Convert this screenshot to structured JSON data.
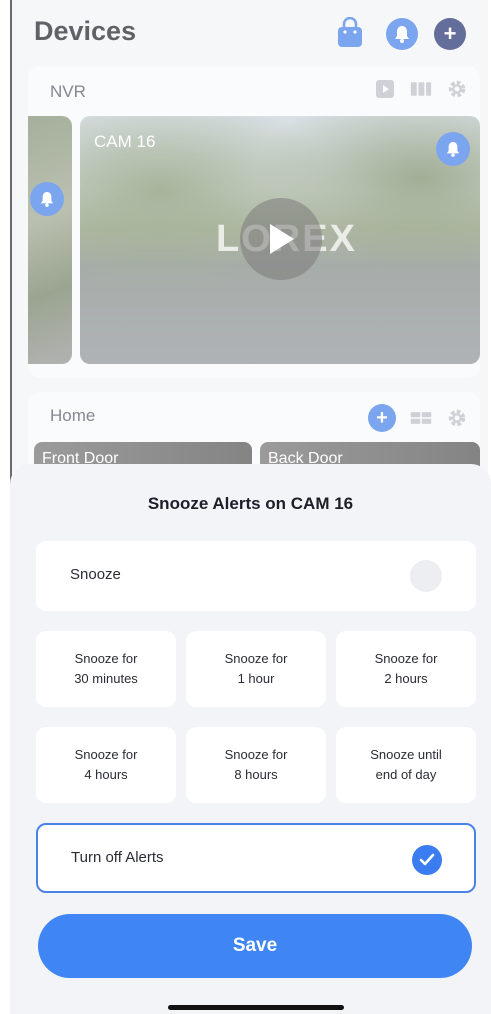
{
  "header": {
    "title": "Devices"
  },
  "nvr": {
    "label": "NVR",
    "camera_name": "CAM 16",
    "watermark": "LOREX"
  },
  "home": {
    "label": "Home",
    "cameras": [
      {
        "name": "Front Door"
      },
      {
        "name": "Back Door"
      }
    ]
  },
  "sheet": {
    "title": "Snooze Alerts on CAM 16",
    "snooze_label": "Snooze",
    "options": [
      {
        "line1": "Snooze for",
        "line2": "30 minutes"
      },
      {
        "line1": "Snooze for",
        "line2": "1 hour"
      },
      {
        "line1": "Snooze for",
        "line2": "2 hours"
      },
      {
        "line1": "Snooze for",
        "line2": "4 hours"
      },
      {
        "line1": "Snooze for",
        "line2": "8 hours"
      },
      {
        "line1": "Snooze until",
        "line2": "end of day"
      }
    ],
    "turn_off_label": "Turn off Alerts",
    "save_label": "Save"
  },
  "colors": {
    "accent": "#3f86f4",
    "dark_navy": "#1a2a6b",
    "selected_border": "#4a82e8"
  },
  "icons": [
    "shopping-bag-icon",
    "bell-icon",
    "plus-icon",
    "play-icon",
    "grid-icon",
    "gear-icon",
    "check-icon"
  ]
}
